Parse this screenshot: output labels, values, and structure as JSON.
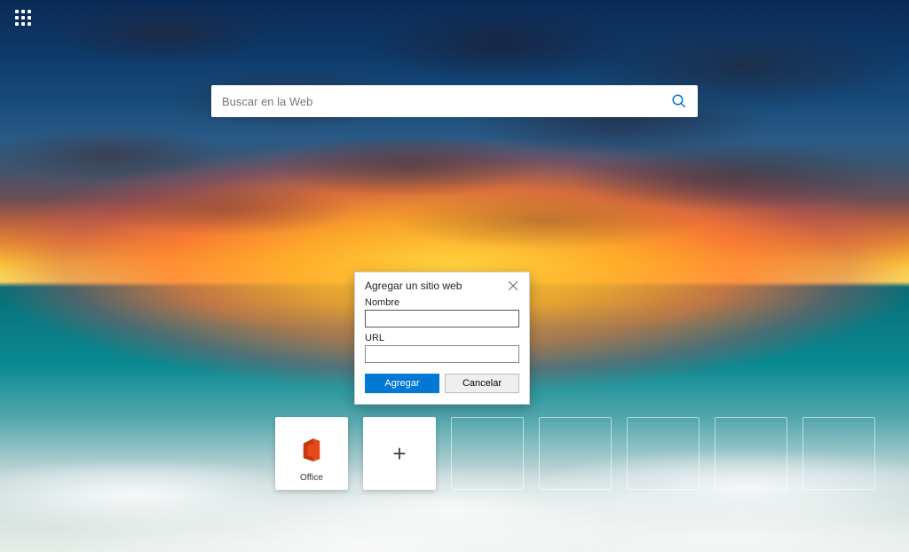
{
  "icons": {
    "apps": "apps-grid-icon",
    "search": "search-icon",
    "close": "close-icon",
    "plus": "plus-icon",
    "office": "office-logo"
  },
  "search": {
    "placeholder": "Buscar en la Web"
  },
  "dialog": {
    "title": "Agregar un sitio web",
    "name_label": "Nombre",
    "name_value": "",
    "url_label": "URL",
    "url_value": "",
    "submit_label": "Agregar",
    "cancel_label": "Cancelar"
  },
  "tiles": [
    {
      "id": "office",
      "label": "Office"
    }
  ],
  "add_tile_label": "",
  "colors": {
    "accent": "#0078d4",
    "office_red": "#e64a19"
  },
  "ghost_placeholders": 5
}
